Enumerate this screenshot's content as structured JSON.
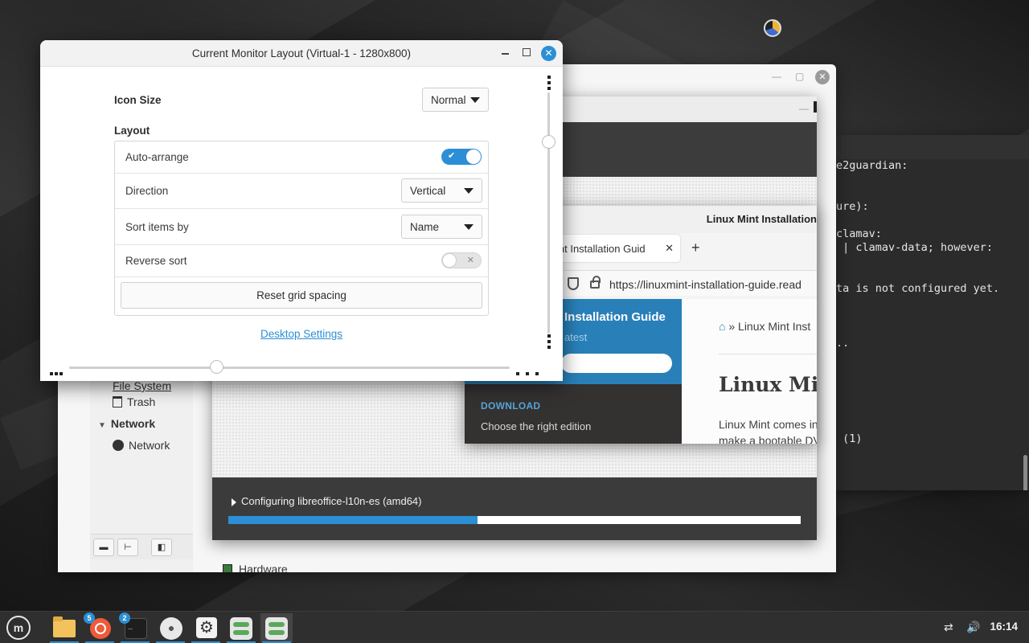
{
  "dialog": {
    "title": "Current Monitor Layout (Virtual-1 - 1280x800)",
    "icon_size_label": "Icon Size",
    "icon_size_value": "Normal",
    "layout_label": "Layout",
    "auto_arrange_label": "Auto-arrange",
    "auto_arrange_on": true,
    "direction_label": "Direction",
    "direction_value": "Vertical",
    "sort_label": "Sort items by",
    "sort_value": "Name",
    "reverse_label": "Reverse sort",
    "reverse_on": false,
    "reset_button": "Reset grid spacing",
    "desktop_settings_link": "Desktop Settings",
    "check_mark": "✔",
    "cross_mark": "✕"
  },
  "file_manager": {
    "items": [
      "File System",
      "Trash"
    ],
    "network_header": "Network",
    "network_item": "Network",
    "hardware_label": "Hardware"
  },
  "installer": {
    "status": "Configuring libreoffice-l10n-es (amd64)",
    "progress": 0.435
  },
  "browser": {
    "window_title": "Linux Mint Installation",
    "tab_title": "int Installation Guid",
    "url": "https://linuxmint-installation-guide.read",
    "side_title": "Installation Guide",
    "side_subtitle": "atest",
    "download_label": "DOWNLOAD",
    "choose_label": "Choose the right edition",
    "breadcrumb": "» Linux Mint Inst",
    "heading": "Linux Min",
    "para1": "Linux Mint comes in",
    "para2": "make a bootable DV"
  },
  "terminal": {
    "lines": [
      "e2guardian:",
      "",
      "",
      "ure):",
      "",
      "clamav:",
      " | clamav-data; however:",
      "",
      "",
      "ta is not configured yet.",
      "",
      "",
      "",
      "..",
      "",
      "",
      "",
      "",
      "",
      "",
      " (1)"
    ]
  },
  "taskbar": {
    "badge_software": "5",
    "badge_terminal": "2",
    "clock": "16:14",
    "mint_logo": "m"
  }
}
